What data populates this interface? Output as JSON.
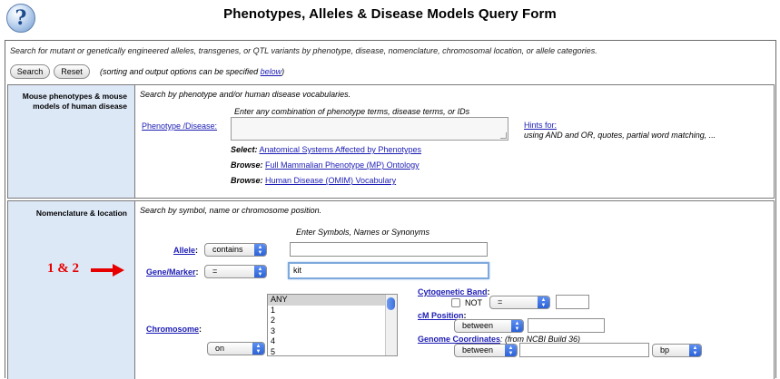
{
  "header": {
    "title": "Phenotypes, Alleles & Disease Models Query Form",
    "help_icon_glyph": "?"
  },
  "intro": {
    "text": "Search for mutant or genetically engineered alleles, transgenes, or QTL variants by phenotype, disease, nomenclature, chromosomal location, or allele categories.",
    "search_label": "Search",
    "reset_label": "Reset",
    "sort_note_prefix": "(sorting and output options can be specified ",
    "sort_note_link": "below",
    "sort_note_suffix": ")"
  },
  "phenotype_section": {
    "label": "Mouse phenotypes & mouse models of human disease",
    "description": "Search by phenotype and/or human disease vocabularies.",
    "instruction": "Enter any combination of phenotype terms, disease terms, or IDs",
    "field_link": "Phenotype /Disease:",
    "hints_link": "Hints for:",
    "hints_text": "using AND and OR, quotes, partial word matching, ...",
    "select_prefix": "Select:",
    "select_link": "Anatomical Systems Affected by Phenotypes",
    "browse1_prefix": "Browse:",
    "browse1_link": "Full Mammalian Phenotype (MP) Ontology",
    "browse2_prefix": "Browse:",
    "browse2_link": "Human Disease (OMIM) Vocabulary"
  },
  "nomenclature_section": {
    "label": "Nomenclature & location",
    "description": "Search by symbol, name or chromosome position.",
    "symbols_header": "Enter Symbols, Names or Synonyms",
    "allele_link": "Allele",
    "allele_operator": "contains",
    "allele_value": "",
    "gene_link": "Gene/Marker",
    "gene_operator": "=",
    "gene_value": "kit",
    "chromosome_link": "Chromosome",
    "chromosome_options": [
      "ANY",
      "1",
      "2",
      "3",
      "4",
      "5"
    ],
    "chromosome_selected": "ANY",
    "chromosome_mode": "on",
    "cyto_link": "Cytogenetic Band",
    "cyto_not_label": "NOT",
    "cyto_operator": "=",
    "cyto_value": "",
    "cm_link": "cM Position",
    "cm_operator": "between",
    "cm_value": "",
    "genome_link": "Genome Coordinates",
    "genome_note": ": (from NCBI Build 36)",
    "genome_operator": "between",
    "genome_value": "",
    "genome_unit": "bp"
  },
  "annotation": {
    "text": "1 & 2",
    "color": "#e60000"
  },
  "colors": {
    "label_bg": "#dde8f7",
    "link": "#1b1bb4",
    "select_arrow": "#2c62d6"
  }
}
